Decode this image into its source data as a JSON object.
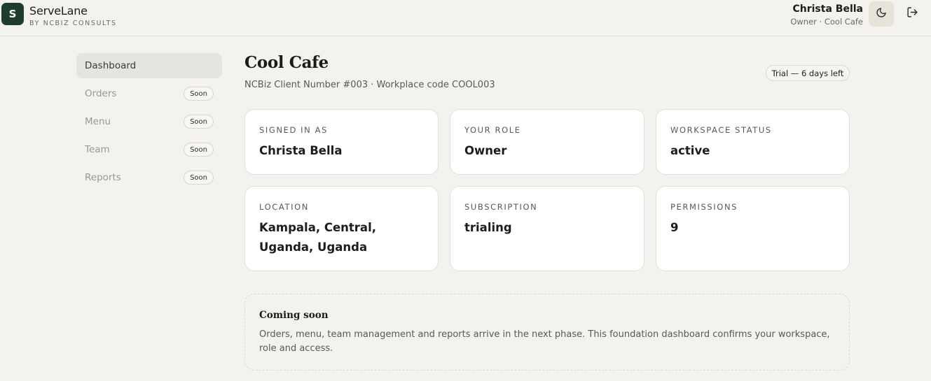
{
  "brand": {
    "logo_letter": "S",
    "name": "ServeLane",
    "subtitle": "BY NCBIZ CONSULTS"
  },
  "user": {
    "name": "Christa Bella",
    "role_line": "Owner · Cool Cafe"
  },
  "header_icons": {
    "theme": "moon-icon",
    "logout": "logout-icon"
  },
  "sidebar": {
    "items": [
      {
        "label": "Dashboard",
        "badge": "",
        "active": true
      },
      {
        "label": "Orders",
        "badge": "Soon",
        "active": false
      },
      {
        "label": "Menu",
        "badge": "Soon",
        "active": false
      },
      {
        "label": "Team",
        "badge": "Soon",
        "active": false
      },
      {
        "label": "Reports",
        "badge": "Soon",
        "active": false
      }
    ]
  },
  "main": {
    "title": "Cool Cafe",
    "subtitle": "NCBiz Client Number #003 · Workplace code COOL003",
    "trial_badge": "Trial — 6 days left",
    "cards": [
      {
        "label": "Signed in as",
        "value": "Christa Bella"
      },
      {
        "label": "Your role",
        "value": "Owner"
      },
      {
        "label": "Workspace status",
        "value": "active"
      },
      {
        "label": "Location",
        "value": "Kampala, Central, Uganda, Uganda"
      },
      {
        "label": "Subscription",
        "value": "trialing"
      },
      {
        "label": "Permissions",
        "value": "9"
      }
    ],
    "coming_soon": {
      "title": "Coming soon",
      "text": "Orders, menu, team management and reports arrive in the next phase. This foundation dashboard confirms your workspace, role and access."
    }
  }
}
